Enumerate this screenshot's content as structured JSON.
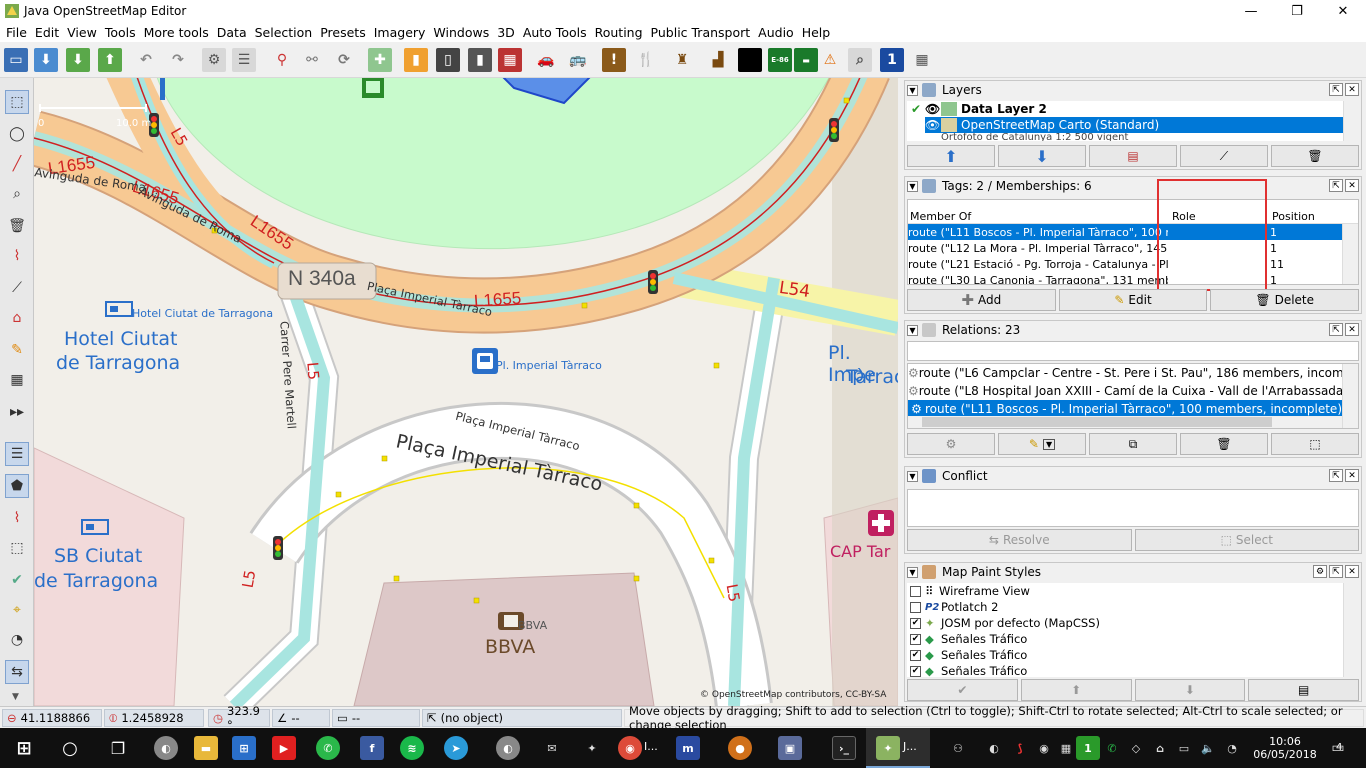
{
  "window": {
    "title": "Java OpenStreetMap Editor",
    "controls": [
      "—",
      "❐",
      "✕"
    ]
  },
  "menu": [
    "File",
    "Edit",
    "View",
    "Tools",
    "More tools",
    "Data",
    "Selection",
    "Presets",
    "Imagery",
    "Windows",
    "3D",
    "Auto Tools",
    "Routing",
    "Public Transport",
    "Audio",
    "Help"
  ],
  "map": {
    "labels": {
      "l1655_a": "L1655",
      "l1655_b": "L1655",
      "l1655_c": "L1655",
      "l1655_d": "L1655",
      "avinguda_a": "Avinguda de Roma",
      "avinguda_b": "Avinguda de Roma",
      "l5_top": "L5",
      "l5_mid": "L5",
      "l5_low": "L5",
      "l5_right": "L5",
      "l54": "L54",
      "n340": "N 340a",
      "placa_upper": "Plaça Imperial Tàrraco",
      "placa_lower_a": "Plaça Imperial Tàrraco",
      "placa_lower_b": "Plaça Imperial Tàrraco",
      "carrer": "Carrer Pere Martell",
      "hotel_small": "Hotel Ciutat de Tarragona",
      "hotel_big_1": "Hotel Ciutat",
      "hotel_big_2": "de Tarragona",
      "sb_1": "SB Ciutat",
      "sb_2": "de Tarragona",
      "bbva_small": "BBVA",
      "bbva_big": "BBVA",
      "stop": "Pl. Imperial Tàrraco",
      "pl_imp_1": "Pl. Impe",
      "pl_imp_2": "Tàrrac",
      "cap": "CAP Tar",
      "scale_left": "0",
      "scale_right": "10.0 m",
      "copyright": "© OpenStreetMap contributors, CC-BY-SA"
    }
  },
  "layers": {
    "title": "Layers",
    "items": [
      {
        "name": "Data Layer 2",
        "bold": true
      },
      {
        "name": "OpenStreetMap Carto (Standard)",
        "selected": true
      },
      {
        "name": "Ortofoto de Catalunya 1:2 500 vigent"
      }
    ]
  },
  "tags": {
    "title": "Tags: 2 / Memberships: 6",
    "columns": [
      "Member Of",
      "Role",
      "Position"
    ],
    "rows": [
      {
        "member": "route (\"L11 Boscos - Pl. Imperial Tàrraco\", 100 me...",
        "role": "",
        "pos": "1"
      },
      {
        "member": "route (\"L12 La Mora - Pl. Imperial Tàrraco\", 145 me...",
        "role": "",
        "pos": "1"
      },
      {
        "member": "route (\"L21 Estació - Pg. Torroja - Catalunya - Pl. I...",
        "role": "",
        "pos": "11"
      },
      {
        "member": "route (\"L30 La Canonja - Tarragona\", 131 member...",
        "role": "",
        "pos": "1"
      }
    ],
    "buttons": {
      "add": "Add",
      "edit": "Edit",
      "delete": "Delete"
    }
  },
  "relations": {
    "title": "Relations: 23",
    "rows": [
      "route (\"L6 Campclar - Centre - St. Pere i St. Pau\", 186 members, incomplete)",
      "route (\"L8 Hospital Joan XXIII - Camí de la Cuixa - Vall de l'Arrabassada\", 134 members, incomplete)",
      "route (\"L11 Boscos - Pl. Imperial Tàrraco\", 100 members, incomplete)"
    ]
  },
  "conflict": {
    "title": "Conflict",
    "resolve": "Resolve",
    "select": "Select"
  },
  "paint": {
    "title": "Map Paint Styles",
    "items": [
      {
        "label": "Wireframe View",
        "checked": false,
        "icon": "wireframe"
      },
      {
        "label": "Potlatch 2",
        "checked": false,
        "icon": "P2"
      },
      {
        "label": "JOSM por defecto (MapCSS)",
        "checked": true,
        "icon": "josm"
      },
      {
        "label": "Señales Tráfico",
        "checked": true,
        "icon": "sign"
      },
      {
        "label": "Señales Tráfico",
        "checked": true,
        "icon": "sign"
      },
      {
        "label": "Señales Tráfico",
        "checked": true,
        "icon": "sign"
      }
    ]
  },
  "status": {
    "lat": "41.1188866",
    "lon": "1.2458928",
    "heading": "323.9 °",
    "angle": "--",
    "distance": "--",
    "object": "(no object)",
    "help": "Move objects by dragging; Shift to add to selection (Ctrl to toggle); Shift-Ctrl to rotate selected; Alt-Ctrl to scale selected; or change selection"
  },
  "taskbar": {
    "time": "10:06",
    "date": "06/05/2018",
    "notifications": "4",
    "chrome_label": "I...",
    "josm_label": "J..."
  },
  "colors": {
    "road_orange": "#f7c993",
    "route_cyan": "#a8e5e0",
    "park_green": "#c8facc",
    "route_red": "#d02020",
    "selected_blue": "#0078d7",
    "highlight_red": "#e03030"
  }
}
